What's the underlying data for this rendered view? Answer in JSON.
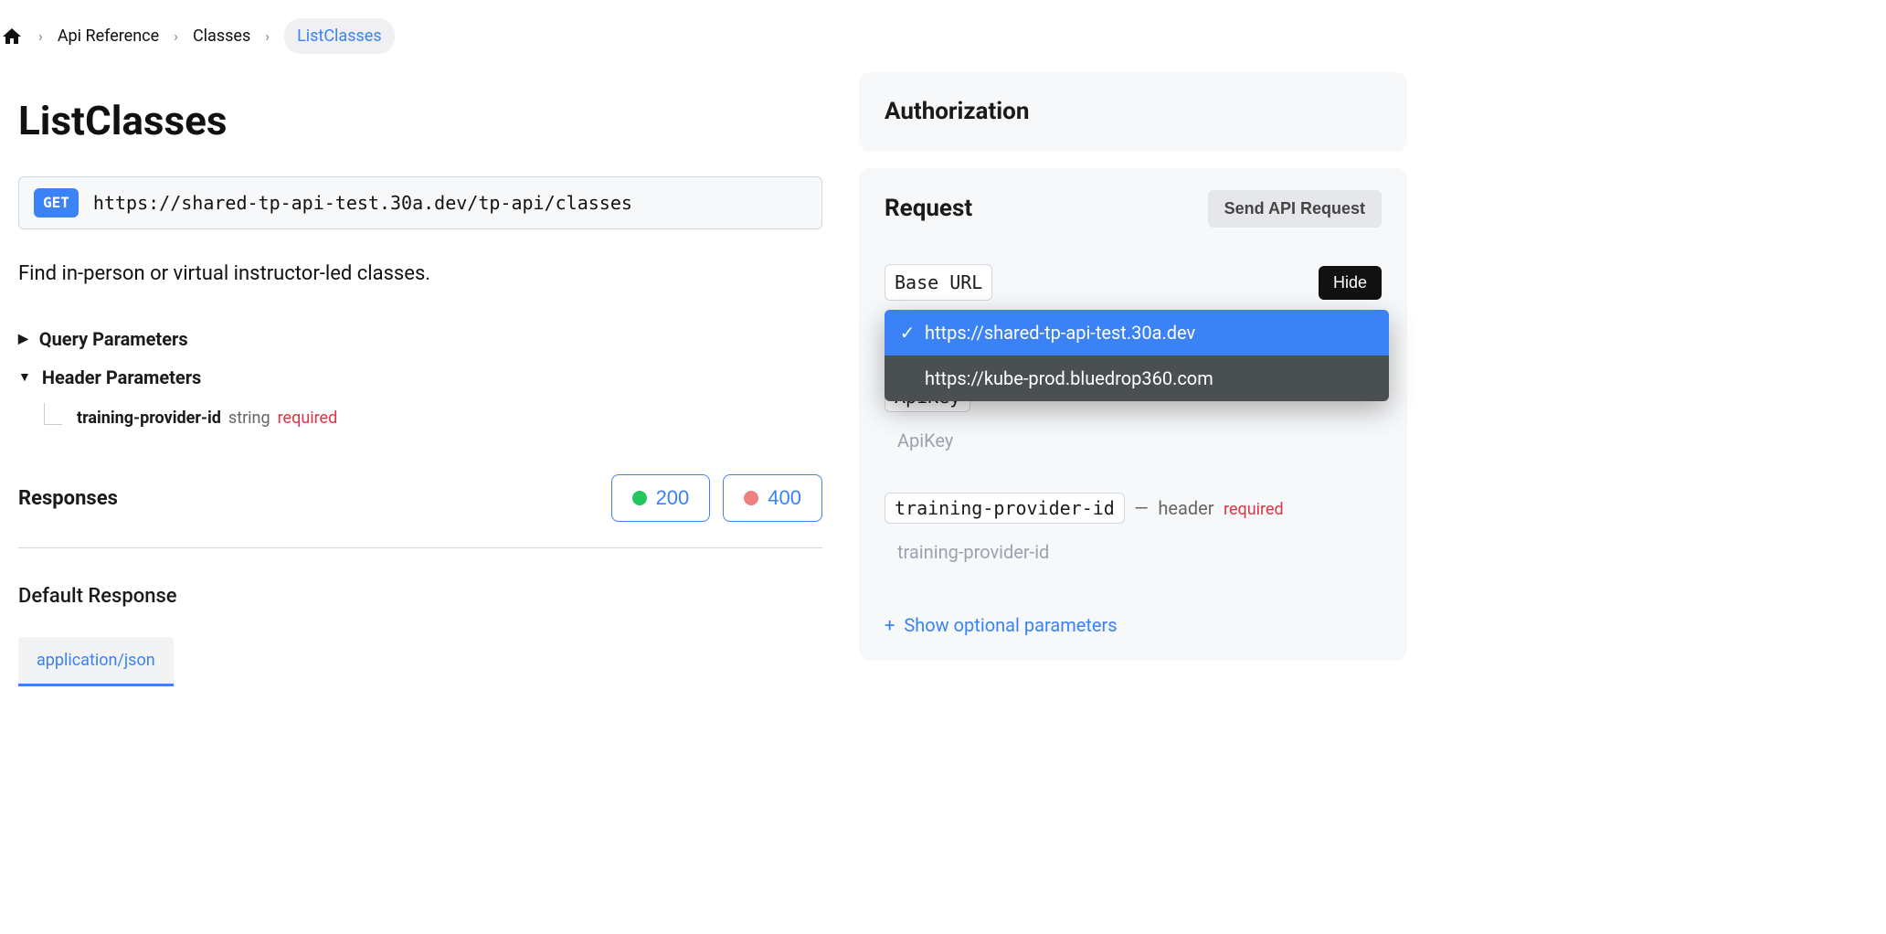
{
  "breadcrumb": {
    "items": [
      {
        "label": "Api Reference"
      },
      {
        "label": "Classes"
      },
      {
        "label": "ListClasses"
      }
    ]
  },
  "page": {
    "title": "ListClasses",
    "method": "GET",
    "endpoint": "https://shared-tp-api-test.30a.dev/tp-api/classes",
    "description": "Find in-person or virtual instructor-led classes."
  },
  "params": {
    "query_heading": "Query Parameters",
    "header_heading": "Header Parameters",
    "header_items": [
      {
        "name": "training-provider-id",
        "type": "string",
        "required": "required"
      }
    ]
  },
  "responses": {
    "heading": "Responses",
    "statuses": [
      {
        "code": "200",
        "color": "green"
      },
      {
        "code": "400",
        "color": "red"
      }
    ],
    "default_title": "Default Response",
    "tab": "application/json"
  },
  "sidebar": {
    "authorization_title": "Authorization",
    "request_title": "Request",
    "send_button": "Send API Request",
    "base_url_label": "Base URL",
    "hide_button": "Hide",
    "dropdown_options": [
      "https://shared-tp-api-test.30a.dev",
      "https://kube-prod.bluedrop360.com"
    ],
    "apikey_label": "ApiKey",
    "apikey_placeholder": "ApiKey",
    "tpid_label": "training-provider-id",
    "tpid_separator": "—",
    "tpid_location": "header",
    "tpid_required": "required",
    "tpid_placeholder": "training-provider-id",
    "optional_label": "Show optional parameters"
  }
}
